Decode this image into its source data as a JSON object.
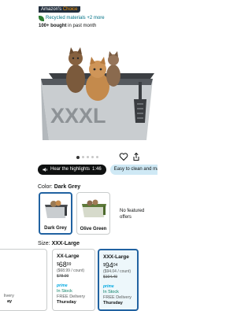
{
  "badge": {
    "text": "Amazon's",
    "suffix": "Choice"
  },
  "recycled": {
    "text": "Recycled materials +2 more"
  },
  "bought": {
    "bold": "100+ bought",
    "rest": " in past month"
  },
  "hero": {
    "lettering": "XXXL",
    "colors": {
      "box": "#cfd3d6",
      "rim": "#3c3f43",
      "scoop": "#3a3d41"
    }
  },
  "carousel": {
    "dots": 5,
    "active": 1
  },
  "highlights": {
    "hear_label": "Hear the highlights",
    "duration": "1:46",
    "easy_label": "Easy to clean and ma"
  },
  "color": {
    "label": "Color:",
    "value": "Dark Grey"
  },
  "swatches": [
    {
      "name": "Dark Grey",
      "selected": true
    },
    {
      "name": "Olive Green",
      "selected": false
    }
  ],
  "no_featured": "No featured offers",
  "size": {
    "label": "Size:",
    "value": "XXX-Large"
  },
  "size_cards": [
    {
      "lines": [
        "",
        "",
        "",
        "",
        "",
        "",
        "livery",
        "ay"
      ],
      "selected": false
    },
    {
      "name": "XX-Large",
      "price_currency": "$",
      "price_whole": "68",
      "price_frac": "99",
      "unit": "($68.99 / count)",
      "list": "$78.99",
      "prime": "prime",
      "stock": "In Stock",
      "delivery": "FREE Delivery",
      "day": "Thursday",
      "selected": false
    },
    {
      "name": "XXX-Large",
      "price_currency": "$",
      "price_whole": "94",
      "price_frac": "04",
      "unit": "($94.04 / count)",
      "list": "$104.49",
      "prime": "prime",
      "stock": "In Stock",
      "delivery": "FREE Delivery",
      "day": "Thursday",
      "selected": true
    }
  ]
}
